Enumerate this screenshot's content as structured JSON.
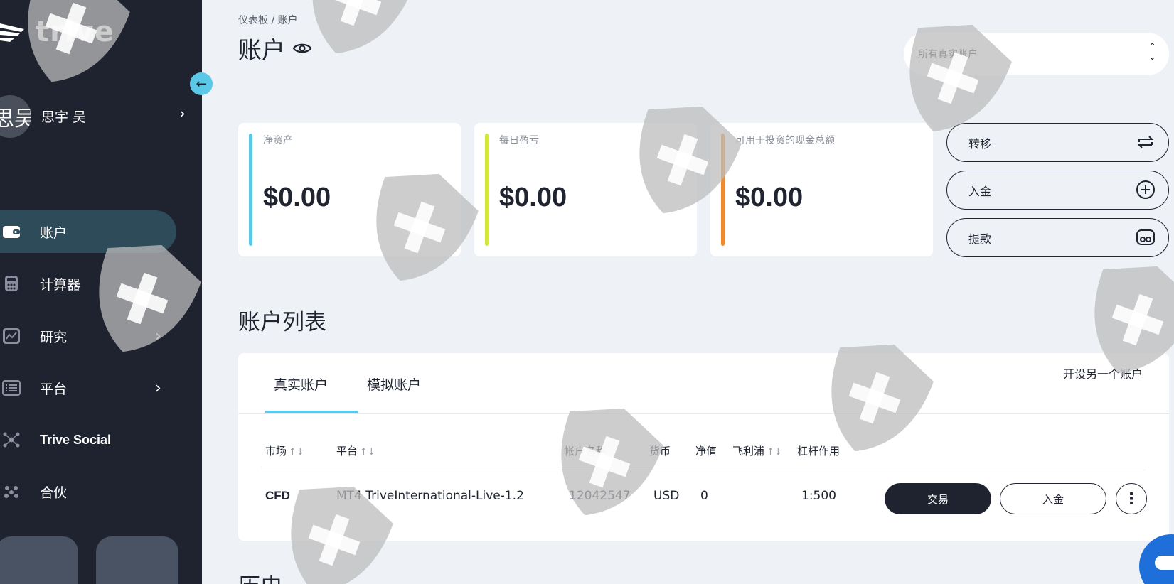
{
  "sidebar": {
    "brand": "trive",
    "user": {
      "avatar_text": "思吴",
      "name": "思宇 吴"
    },
    "items": [
      {
        "label": "账户",
        "icon": "wallet-icon",
        "active": true
      },
      {
        "label": "计算器",
        "icon": "calculator-icon"
      },
      {
        "label": "研究",
        "icon": "chart-icon",
        "has_submenu": true
      },
      {
        "label": "平台",
        "icon": "monitor-icon",
        "has_submenu": true
      },
      {
        "label": "Trive Social",
        "icon": "network-icon"
      },
      {
        "label": "合伙",
        "icon": "people-icon"
      }
    ]
  },
  "breadcrumb": {
    "root": "仪表板",
    "sep": "/",
    "current": "账户"
  },
  "page_title": "账户",
  "account_select": {
    "value": "所有真实账户"
  },
  "stats": [
    {
      "label": "净资产",
      "value": "$0.00",
      "color": "#5cc8e8"
    },
    {
      "label": "每日盈亏",
      "value": "$0.00",
      "color": "#d4e83a"
    },
    {
      "label": "可用于投资的现金总额",
      "value": "$0.00",
      "color": "#f08a2c"
    }
  ],
  "actions": {
    "transfer": "转移",
    "deposit": "入金",
    "withdraw": "提款"
  },
  "accounts": {
    "title": "账户列表",
    "tabs": [
      "真实账户",
      "模拟账户"
    ],
    "open_link": "开设另一个账户",
    "columns": [
      "市场",
      "平台",
      "帐户名称",
      "货币",
      "净值",
      "飞利浦",
      "杠杆作用"
    ],
    "rows": [
      {
        "market": "CFD",
        "platform": "MT4 TriveInternational-Live-1.2",
        "account": "12042547",
        "currency": "USD",
        "equity": "0",
        "philips": "",
        "leverage": "1:500"
      }
    ],
    "trade_label": "交易",
    "deposit_label": "入金"
  },
  "history_title": "历史"
}
